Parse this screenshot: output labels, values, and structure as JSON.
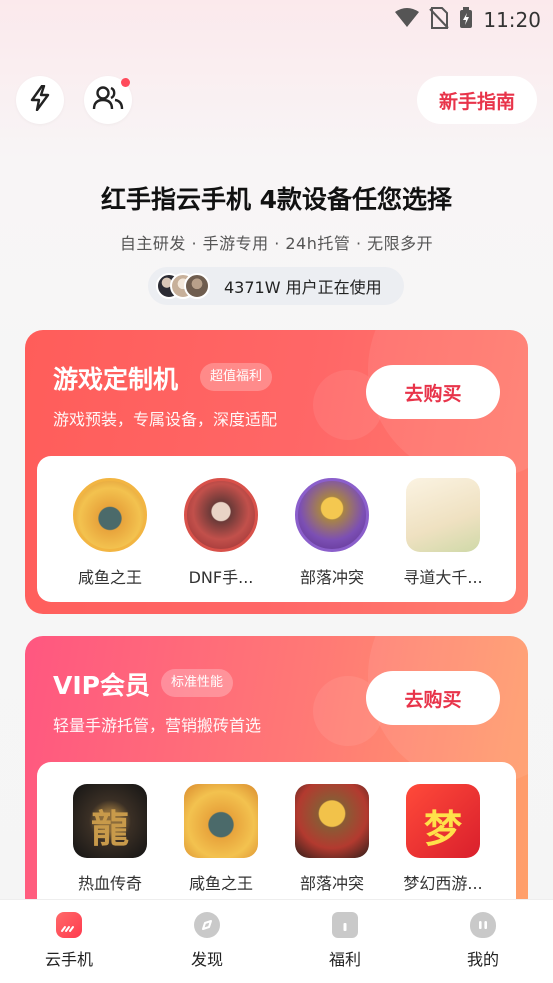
{
  "status_bar": {
    "time": "11:20"
  },
  "header": {
    "guide_label": "新手指南"
  },
  "hero": {
    "title": "红手指云手机 4款设备任您选择",
    "subtitle": "自主研发 · 手游专用 · 24h托管 · 无限多开",
    "users_text": "4371W 用户正在使用"
  },
  "cards": [
    {
      "title": "游戏定制机",
      "badge": "超值福利",
      "desc": "游戏预装，专属设备，深度适配",
      "buy_label": "去购买",
      "games": [
        {
          "label": "咸鱼之王",
          "icon": "xianyu-icon"
        },
        {
          "label": "DNF手...",
          "icon": "dnf-icon"
        },
        {
          "label": "部落冲突",
          "icon": "clash-icon"
        },
        {
          "label": "寻道大千...",
          "icon": "xundao-icon"
        }
      ]
    },
    {
      "title": "VIP会员",
      "badge": "标准性能",
      "desc": "轻量手游托管，营销搬砖首选",
      "buy_label": "去购买",
      "games": [
        {
          "label": "热血传奇",
          "icon": "rexue-icon",
          "glyph": "龍"
        },
        {
          "label": "咸鱼之王",
          "icon": "xianyu-icon"
        },
        {
          "label": "部落冲突",
          "icon": "clash-icon"
        },
        {
          "label": "梦幻西游...",
          "icon": "menghuan-icon",
          "glyph": "梦"
        }
      ]
    }
  ],
  "tabbar": [
    {
      "label": "云手机",
      "icon": "cloud-phone-icon",
      "active": true
    },
    {
      "label": "发现",
      "icon": "discover-icon"
    },
    {
      "label": "福利",
      "icon": "gift-icon"
    },
    {
      "label": "我的",
      "icon": "profile-icon"
    }
  ],
  "colors": {
    "accent": "#e8344a",
    "card1_bg": "#ff6262",
    "card2_bg": "#ff7a75"
  }
}
